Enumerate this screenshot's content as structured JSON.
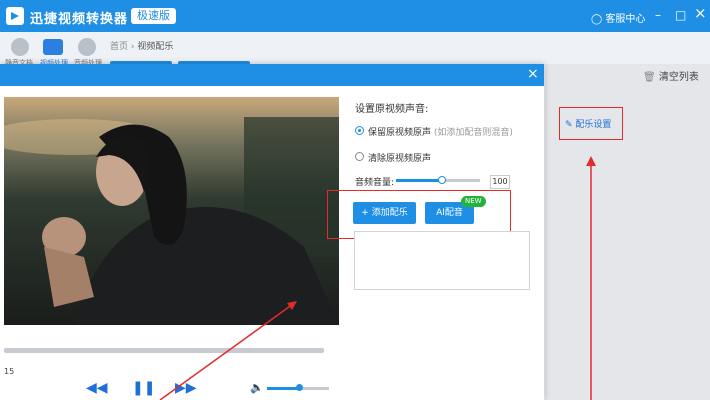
{
  "app": {
    "title": "迅捷视频转换器",
    "edition": "极速版",
    "service": "客服中心"
  },
  "window_controls": {
    "minimize": "–",
    "maximize": "□",
    "close": "×"
  },
  "toolbar": {
    "tool1_label": "静音文档",
    "tool2_label": "视频处理",
    "tool3_label": "音频处理"
  },
  "breadcrumb": {
    "home": "首页",
    "sep": "›",
    "current": "视频配乐"
  },
  "right_panel": {
    "clear_list": "清空列表",
    "music_settings": "配乐设置"
  },
  "dialog": {
    "close_glyph": "×",
    "section_title": "设置原视频声音:",
    "option_keep": "保留原视频原声",
    "option_keep_note": "(如添加配音则混音)",
    "option_clear": "清除原视频原声",
    "audio_label": "音频音量:",
    "audio_value": "100",
    "add_music_btn": "+ 添加配乐",
    "ai_dub_btn": "AI配音",
    "new_badge": "NEW",
    "time_fragment": "15"
  },
  "player": {
    "rewind_glyph": "◀◀",
    "pause_glyph": "❚❚",
    "forward_glyph": "▶▶",
    "volume_glyph": "🔈"
  },
  "colors": {
    "brand": "#1f8fe6",
    "annotation": "#e12c2c",
    "new_badge": "#21b33a"
  }
}
